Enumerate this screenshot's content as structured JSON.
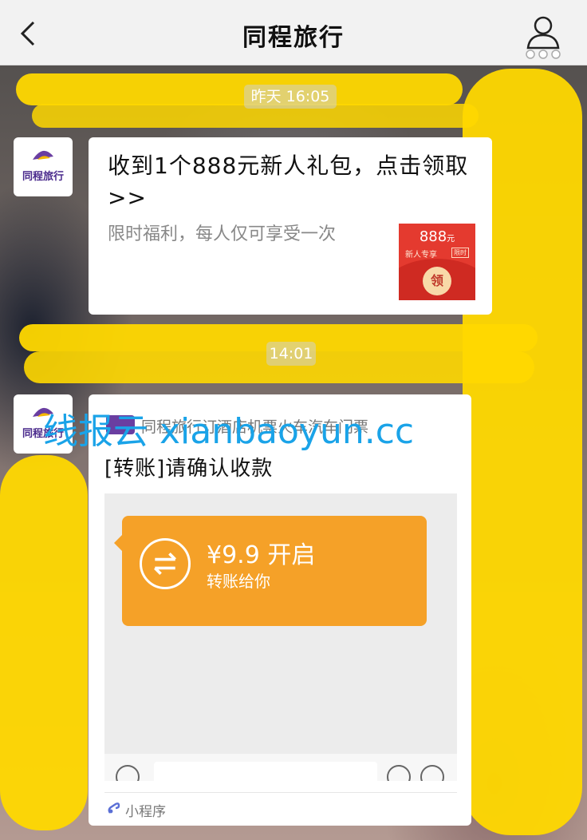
{
  "navbar": {
    "title": "同程旅行",
    "back_icon": "chevron-left-icon",
    "profile_icon": "person-more-icon"
  },
  "timestamps": {
    "first": "昨天 16:05",
    "second": "14:01"
  },
  "sender": {
    "name": "同程旅行"
  },
  "message1": {
    "title": "收到1个888元新人礼包，点击领取>>",
    "description": "限时福利，每人仅可享受一次",
    "redpack": {
      "amount": "888",
      "unit": "元",
      "subtitle": "新人专享",
      "tag": "限时",
      "button": "领"
    }
  },
  "message2": {
    "source": "同程旅行订酒店机票火车汽车门票",
    "title": "[转账]请确认收款",
    "transfer": {
      "amount": "¥9.9 开启",
      "subtitle": "转账给你"
    },
    "footer": "小程序"
  },
  "watermark": "线报云 xianbaoyun.cc",
  "colors": {
    "nav_bg": "#f2f2f2",
    "transfer_orange": "#f5a128",
    "redpack_red": "#e43a2f",
    "watermark_blue": "#1aa3e8",
    "scribble_yellow": "#ffd800"
  }
}
